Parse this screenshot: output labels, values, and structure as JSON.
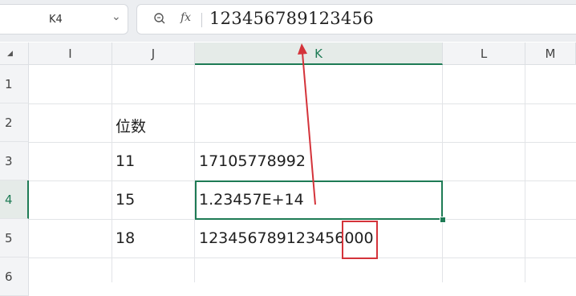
{
  "name_box": {
    "value": "K4"
  },
  "formula_bar": {
    "value": "123456789123456",
    "fx_label": "fx"
  },
  "columns": {
    "I": "I",
    "J": "J",
    "K": "K",
    "L": "L",
    "M": "M"
  },
  "rows": {
    "r1": "1",
    "r2": "2",
    "r3": "3",
    "r4": "4",
    "r5": "5",
    "r6": "6"
  },
  "cells": {
    "J2": "位数",
    "J3": "11",
    "K3": "17105778992",
    "J4": "15",
    "K4": "1.23457E+14",
    "J5": "18",
    "K5_main": "123456789123456",
    "K5_zeros": "000"
  },
  "colors": {
    "accent": "#1e7b55",
    "annotation": "#d4333a"
  }
}
